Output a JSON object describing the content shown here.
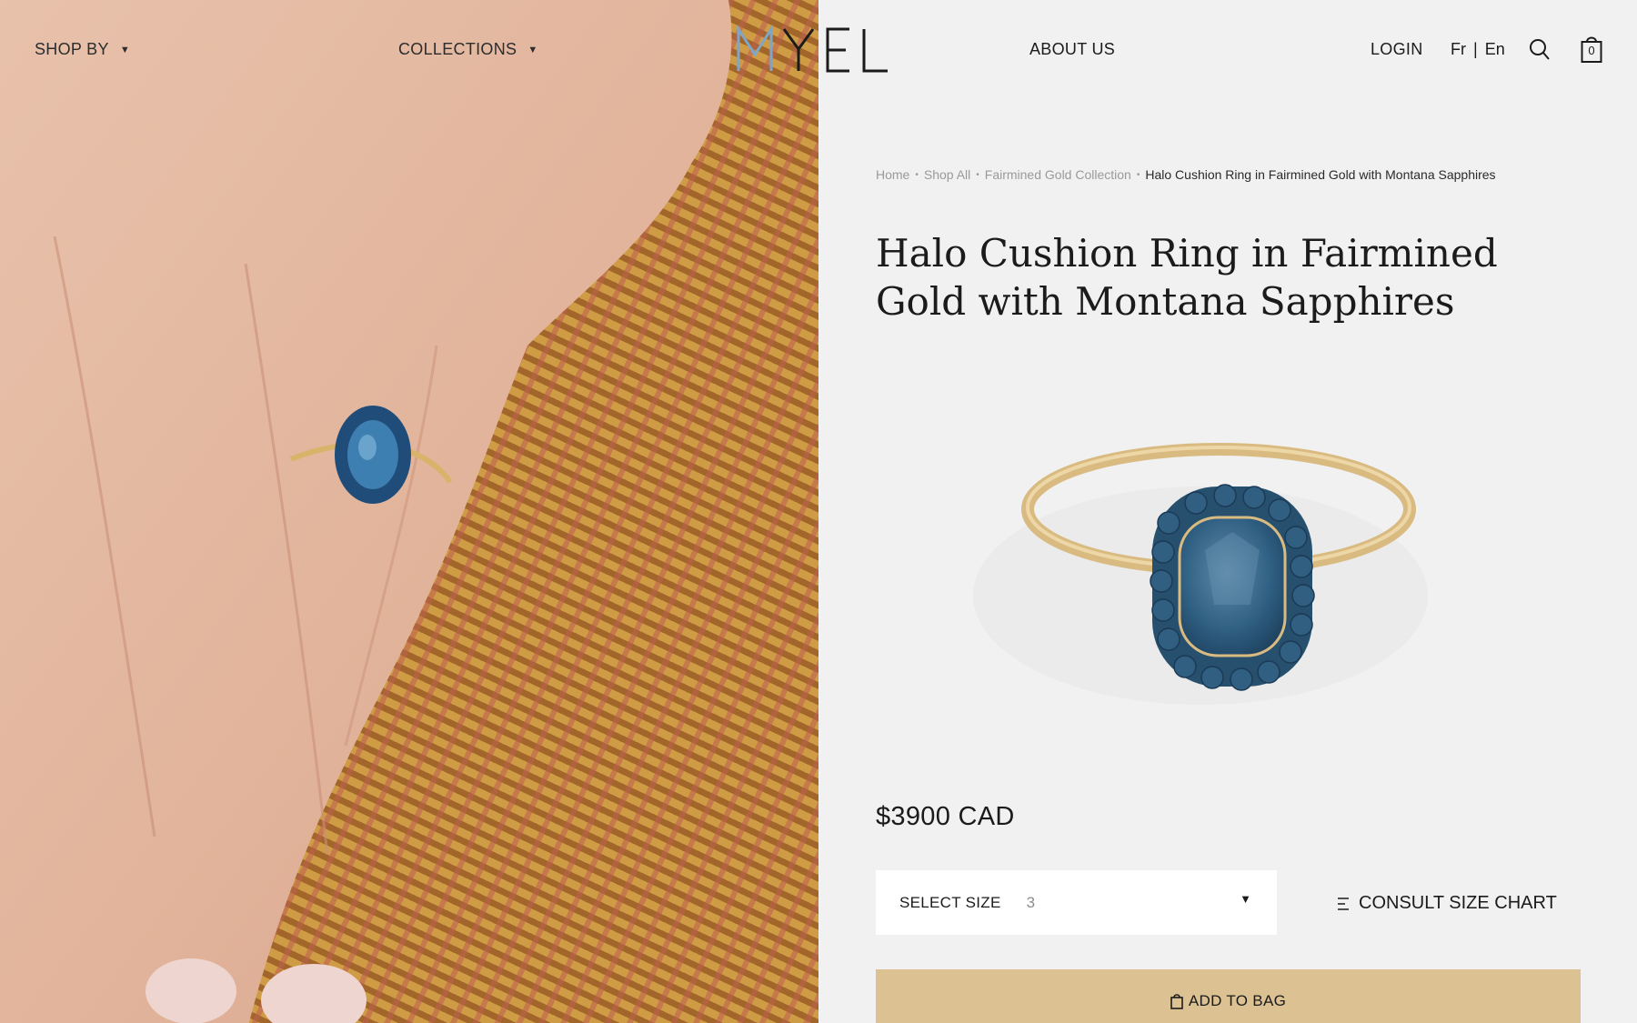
{
  "nav": {
    "shop_by": "SHOP BY",
    "collections": "COLLECTIONS",
    "logo": "MYEL",
    "about": "ABOUT US",
    "login": "LOGIN",
    "lang_fr": "Fr",
    "lang_sep": "|",
    "lang_en": "En",
    "bag_count": "0"
  },
  "breadcrumb": {
    "items": [
      "Home",
      "Shop All",
      "Fairmined Gold Collection"
    ],
    "current": "Halo Cushion Ring in Fairmined Gold with Montana Sapphires"
  },
  "product": {
    "title": "Halo Cushion Ring in Fairmined Gold with Montana Sapphires",
    "price": "$3900 CAD",
    "size_label": "SELECT SIZE",
    "size_value": "3",
    "size_chart": "CONSULT SIZE CHART",
    "add_to_bag": "ADD TO BAG"
  },
  "colors": {
    "accent": "#dcc193",
    "background": "#f1f1f1",
    "sapphire": "#2f5f82"
  }
}
